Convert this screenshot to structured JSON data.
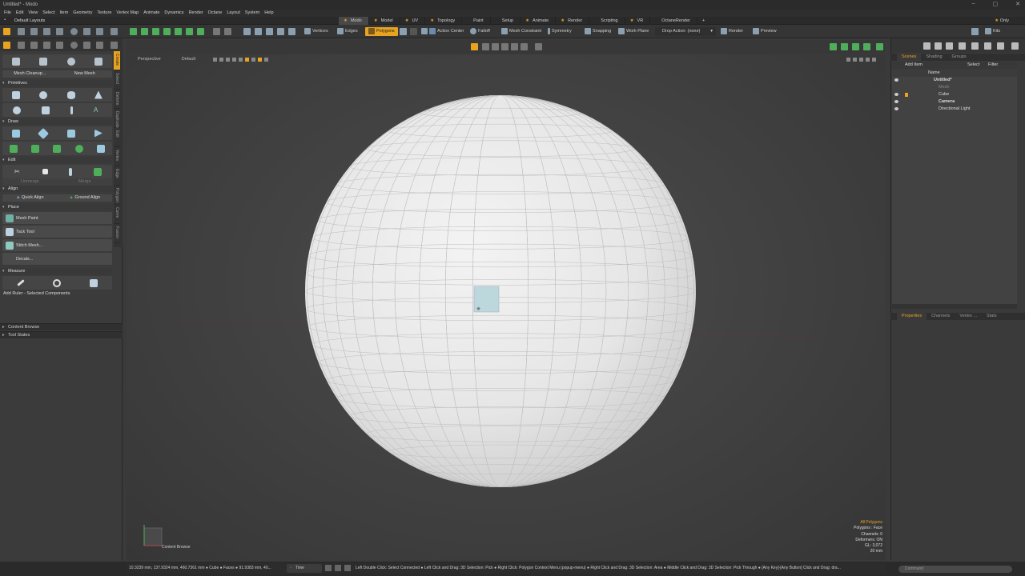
{
  "window": {
    "title": "Untitled* - Modo",
    "controls": [
      "–",
      "▢",
      "✕"
    ]
  },
  "menu": [
    "File",
    "Edit",
    "View",
    "Select",
    "Item",
    "Geometry",
    "Texture",
    "Vertex Map",
    "Animate",
    "Dynamics",
    "Render",
    "Octane",
    "Layout",
    "System",
    "Help"
  ],
  "layout_label": "Default Layouts",
  "layout_tabs": [
    {
      "label": "Modo",
      "star": true,
      "active": true
    },
    {
      "label": "Model",
      "star": true
    },
    {
      "label": "UV",
      "star": true
    },
    {
      "label": "Topology",
      "star": true
    },
    {
      "label": "Paint",
      "star": false
    },
    {
      "label": "Setup",
      "star": false
    },
    {
      "label": "Animate",
      "star": true
    },
    {
      "label": "Render",
      "star": true
    },
    {
      "label": "Scripting",
      "star": false
    },
    {
      "label": "VR",
      "star": true
    },
    {
      "label": "OctaneRender",
      "star": false
    },
    {
      "label": "+",
      "star": false
    }
  ],
  "only_label": "Only",
  "toolbar": {
    "vertices": "Vertices",
    "edges": "Edges",
    "polygons": "Polygons",
    "action_center": "Action Center",
    "falloff": "Falloff",
    "mesh_constraint": "Mesh Constraint",
    "symmetry": "Symmetry",
    "snapping": "Snapping",
    "work_plane": "Work Plane",
    "drop_action": "Drop Action: (none)",
    "render": "Render",
    "preview": "Preview",
    "kits": "Kits"
  },
  "left_panel": {
    "mesh_cleanup": "Mesh Cleanup...",
    "new_mesh": "New Mesh",
    "sections": {
      "primitives": "Primitives",
      "draw": "Draw",
      "edit": "Edit",
      "align": "Align",
      "place": "Place",
      "measure": "Measure"
    },
    "edit_buttons": [
      "Unmerge",
      "Merge"
    ],
    "align_buttons": [
      "Quick Align",
      "Ground Align"
    ],
    "place_items": [
      "Mesh Paint",
      "Tack Tool",
      "Stitch Mesh...",
      "Decals..."
    ],
    "add_ruler": "Add Ruler - Selected Components",
    "vertical_tabs": [
      "Create",
      "Select",
      "Deform",
      "Duplicate",
      "Edit",
      "Vertex",
      "Edge",
      "Polygon",
      "Curve",
      "Fusion"
    ],
    "collapsed": [
      "Content Browse",
      "Tool States"
    ]
  },
  "viewport": {
    "view": "Perspective",
    "shading": "Default",
    "stats": {
      "title": "All Polygons",
      "l1": "Polygons : Face",
      "l2": "Channels: 0",
      "l3": "Deformers: ON",
      "l4": "GL: 3,072",
      "l5": "20 mm"
    },
    "content_browse": "Content Browse"
  },
  "right_panel": {
    "tabs": [
      "Scenes",
      "Shading",
      "Groups"
    ],
    "add_item": "Add Item",
    "select": "Select",
    "filter": "Filter",
    "name_col": "Name",
    "items": [
      "Untitled*",
      "Mesh",
      "Cube",
      "Camera",
      "Directional Light"
    ],
    "prop_tabs": [
      "Properties",
      "Channels",
      "Vertex ...",
      "Stats"
    ],
    "command": "Command"
  },
  "status": {
    "readout": "10.3239 mm, 137.9324 mm, 460.7361 mm ● Cube ● Faces ● 91.9383 mm, 40...",
    "time": "Time",
    "hints": "Left Double Click: Select Connected ● Left Click and Drag: 3D Selection: Pick ● Right Click: Polygon Context Menu (popup-menu) ● Right Click and Drag: 3D Selection: Area ● Middle Click and Drag: 3D Selection: Pick Through ● [Any Key]-[Any Button] Click and Drag: dra..."
  },
  "colors": {
    "accent": "#e8a321",
    "panel": "#3b3b3b",
    "viewport": "#444444",
    "sphere": "#e6e6e6",
    "selected_face": "#bcd8dc"
  }
}
